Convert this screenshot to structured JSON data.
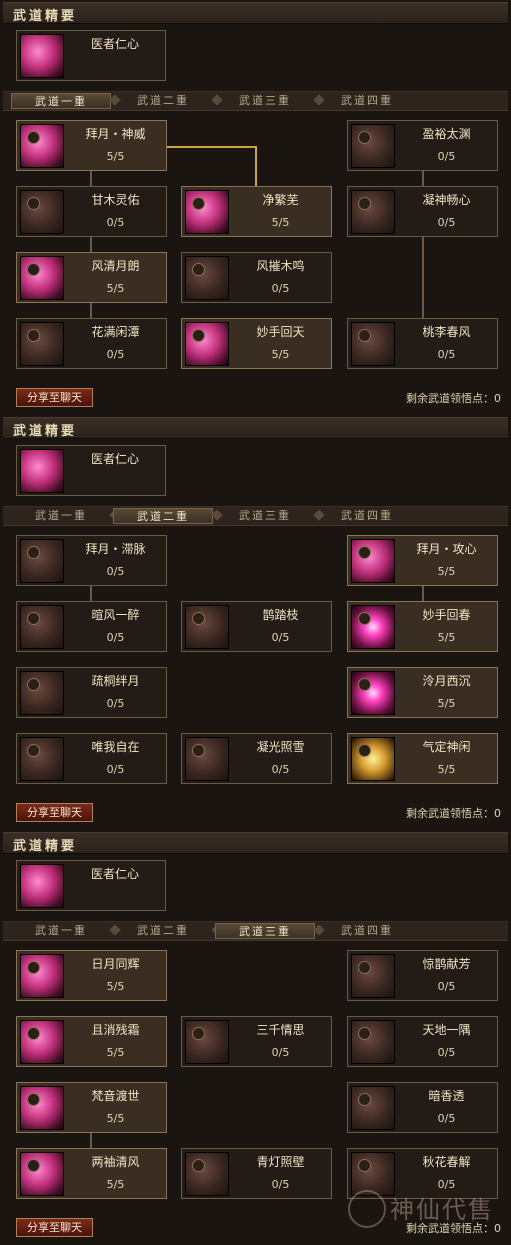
{
  "panels": [
    {
      "header": "武道精要",
      "core": {
        "name": "医者仁心"
      },
      "tabs": [
        "武道一重",
        "武道二重",
        "武道三重",
        "武道四重"
      ],
      "selected_tab": 0,
      "skills": [
        {
          "name": "拜月・神威",
          "count": "5/5",
          "state": "on",
          "col": 0,
          "row": 0
        },
        {
          "name": "盈裕太渊",
          "count": "0/5",
          "state": "off",
          "col": 2,
          "row": 0
        },
        {
          "name": "甘木灵佑",
          "count": "0/5",
          "state": "off",
          "col": 0,
          "row": 1
        },
        {
          "name": "净繁芜",
          "count": "5/5",
          "state": "on",
          "col": 1,
          "row": 1
        },
        {
          "name": "凝神畅心",
          "count": "0/5",
          "state": "off",
          "col": 2,
          "row": 1
        },
        {
          "name": "风清月朗",
          "count": "5/5",
          "state": "on",
          "col": 0,
          "row": 2
        },
        {
          "name": "风摧木鸣",
          "count": "0/5",
          "state": "off",
          "col": 1,
          "row": 2
        },
        {
          "name": "花满闲潭",
          "count": "0/5",
          "state": "off",
          "col": 0,
          "row": 3
        },
        {
          "name": "妙手回天",
          "count": "5/5",
          "state": "on",
          "col": 1,
          "row": 3
        },
        {
          "name": "桃李春风",
          "count": "0/5",
          "state": "off",
          "col": 2,
          "row": 3
        }
      ],
      "share_label": "分享至聊天",
      "points_label": "剩余武道领悟点：0"
    },
    {
      "header": "武道精要",
      "core": {
        "name": "医者仁心"
      },
      "tabs": [
        "武道一重",
        "武道二重",
        "武道三重",
        "武道四重"
      ],
      "selected_tab": 1,
      "skills": [
        {
          "name": "拜月・滞脉",
          "count": "0/5",
          "state": "off",
          "col": 0,
          "row": 0
        },
        {
          "name": "拜月・攻心",
          "count": "5/5",
          "state": "on",
          "col": 2,
          "row": 0
        },
        {
          "name": "暄风一醉",
          "count": "0/5",
          "state": "off",
          "col": 0,
          "row": 1
        },
        {
          "name": "鹊踏枝",
          "count": "0/5",
          "state": "off",
          "col": 1,
          "row": 1
        },
        {
          "name": "妙手回春",
          "count": "5/5",
          "state": "spark",
          "col": 2,
          "row": 1
        },
        {
          "name": "疏桐绊月",
          "count": "0/5",
          "state": "off",
          "col": 0,
          "row": 2
        },
        {
          "name": "泠月西沉",
          "count": "5/5",
          "state": "spark",
          "col": 2,
          "row": 2
        },
        {
          "name": "唯我自在",
          "count": "0/5",
          "state": "off",
          "col": 0,
          "row": 3
        },
        {
          "name": "凝光照雪",
          "count": "0/5",
          "state": "off",
          "col": 1,
          "row": 3
        },
        {
          "name": "气定神闲",
          "count": "5/5",
          "state": "gold",
          "col": 2,
          "row": 3
        }
      ],
      "share_label": "分享至聊天",
      "points_label": "剩余武道领悟点：0"
    },
    {
      "header": "武道精要",
      "core": {
        "name": "医者仁心"
      },
      "tabs": [
        "武道一重",
        "武道二重",
        "武道三重",
        "武道四重"
      ],
      "selected_tab": 2,
      "skills": [
        {
          "name": "日月同辉",
          "count": "5/5",
          "state": "on",
          "col": 0,
          "row": 0
        },
        {
          "name": "惊鹊献芳",
          "count": "0/5",
          "state": "off",
          "col": 2,
          "row": 0
        },
        {
          "name": "且消残霜",
          "count": "5/5",
          "state": "on",
          "col": 0,
          "row": 1
        },
        {
          "name": "三千情思",
          "count": "0/5",
          "state": "off",
          "col": 1,
          "row": 1
        },
        {
          "name": "天地一隅",
          "count": "0/5",
          "state": "off",
          "col": 2,
          "row": 1
        },
        {
          "name": "梵音渡世",
          "count": "5/5",
          "state": "on",
          "col": 0,
          "row": 2
        },
        {
          "name": "暗香透",
          "count": "0/5",
          "state": "off",
          "col": 2,
          "row": 2
        },
        {
          "name": "两袖清风",
          "count": "5/5",
          "state": "on",
          "col": 0,
          "row": 3
        },
        {
          "name": "青灯照壁",
          "count": "0/5",
          "state": "off",
          "col": 1,
          "row": 3
        },
        {
          "name": "秋花春解",
          "count": "0/5",
          "state": "off",
          "col": 2,
          "row": 3
        }
      ],
      "share_label": "分享至聊天",
      "points_label": "剩余武道领悟点：0"
    }
  ],
  "watermark": "神仙代售"
}
